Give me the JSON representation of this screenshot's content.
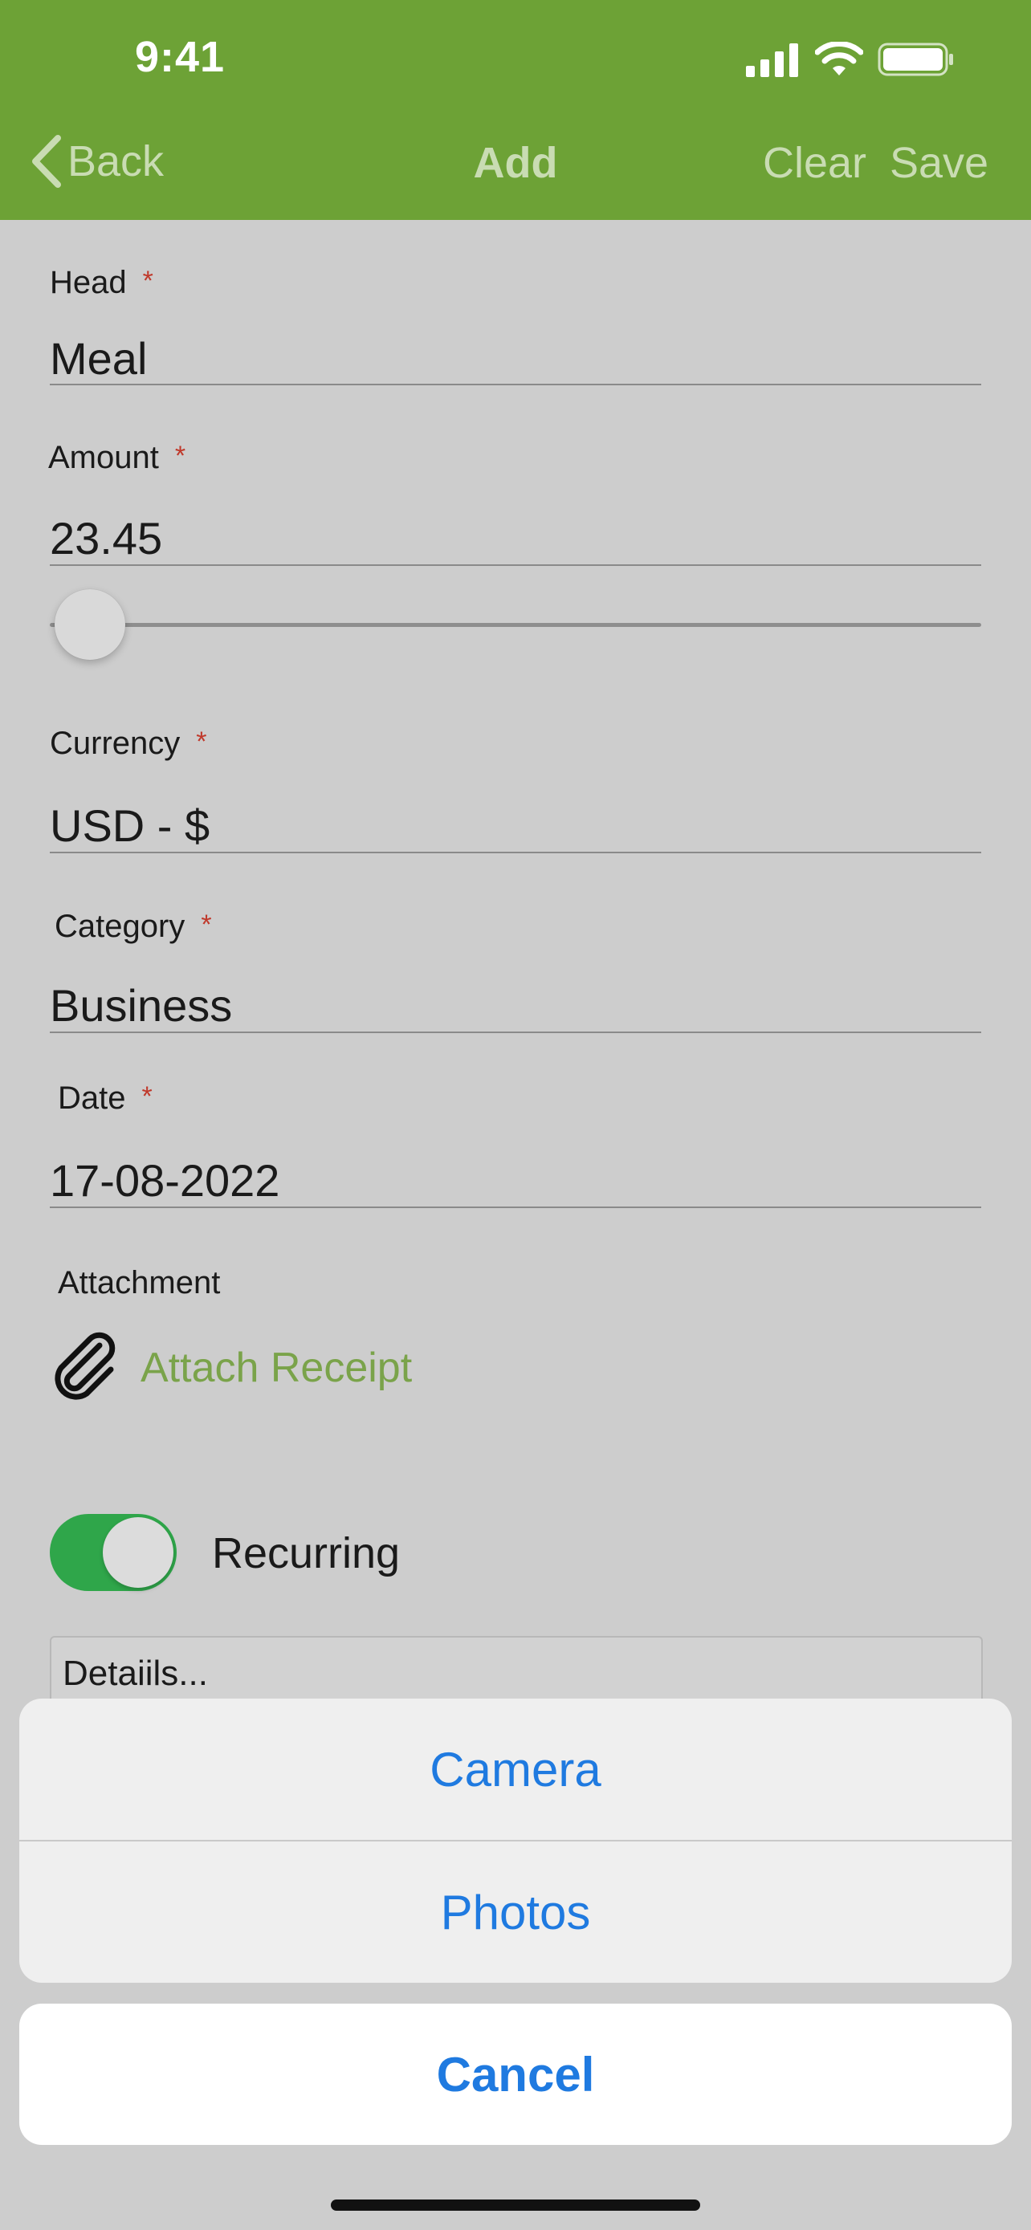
{
  "status_bar": {
    "time": "9:41"
  },
  "nav": {
    "back_label": "Back",
    "title": "Add",
    "clear_label": "Clear",
    "save_label": "Save"
  },
  "form": {
    "required_mark": "*",
    "head": {
      "label": "Head",
      "value": "Meal"
    },
    "amount": {
      "label": "Amount",
      "value": "23.45",
      "slider_level": 0.02
    },
    "currency": {
      "label": "Currency",
      "value": "USD - $"
    },
    "category": {
      "label": "Category",
      "value": "Business"
    },
    "date": {
      "label": "Date",
      "value": "17-08-2022"
    },
    "attachment": {
      "label": "Attachment",
      "link": "Attach Receipt",
      "icon": "paperclip-icon"
    },
    "recurring": {
      "label": "Recurring",
      "on": true
    },
    "details": {
      "placeholder": "Detaiils..."
    }
  },
  "action_sheet": {
    "options": [
      "Camera",
      "Photos"
    ],
    "cancel_label": "Cancel"
  },
  "colors": {
    "header_bg": "#6da236",
    "accent_green": "#7aa34a",
    "toggle_on": "#2fa64a",
    "action_blue": "#1f7ae0",
    "required_red": "#c0392b"
  }
}
